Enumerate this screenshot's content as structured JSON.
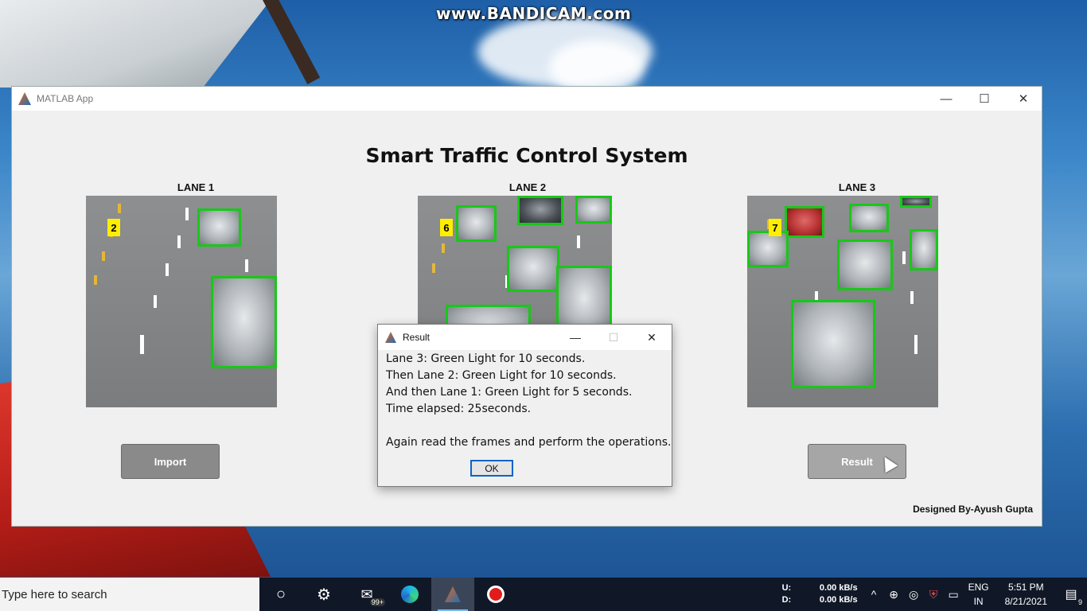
{
  "watermark": "www.BANDICAM.com",
  "window": {
    "title": "MATLAB App",
    "minimize": "—",
    "maximize": "☐",
    "close": "✕"
  },
  "app": {
    "title": "Smart Traffic Control System",
    "lanes": [
      {
        "label": "LANE 1",
        "count": "2"
      },
      {
        "label": "LANE 2",
        "count": "6"
      },
      {
        "label": "LANE 3",
        "count": "7"
      }
    ],
    "import_label": "Import",
    "result_label": "Result",
    "credit": "Designed By-Ayush Gupta"
  },
  "dialog": {
    "title": "Result",
    "lines": [
      "Lane 3: Green Light for 10 seconds.",
      "Then Lane 2: Green Light for 10 seconds.",
      "And then Lane 1: Green Light for 5 seconds.",
      "Time elapsed: 25seconds.",
      "",
      "Again read the frames and perform the operations."
    ],
    "ok_label": "OK",
    "minimize": "—",
    "maximize": "☐",
    "close": "✕"
  },
  "taskbar": {
    "search_placeholder": "Type here to search",
    "mail_badge": "99+",
    "net_up_label": "U:",
    "net_up_value": "0.00 kB/s",
    "net_down_label": "D:",
    "net_down_value": "0.00 kB/s",
    "lang_top": "ENG",
    "lang_bottom": "IN",
    "time": "5:51 PM",
    "date": "8/21/2021",
    "notification_count": "9"
  },
  "colors": {
    "detection_box": "#18c818",
    "count_badge": "#ffee00",
    "taskbar": "#101828"
  }
}
